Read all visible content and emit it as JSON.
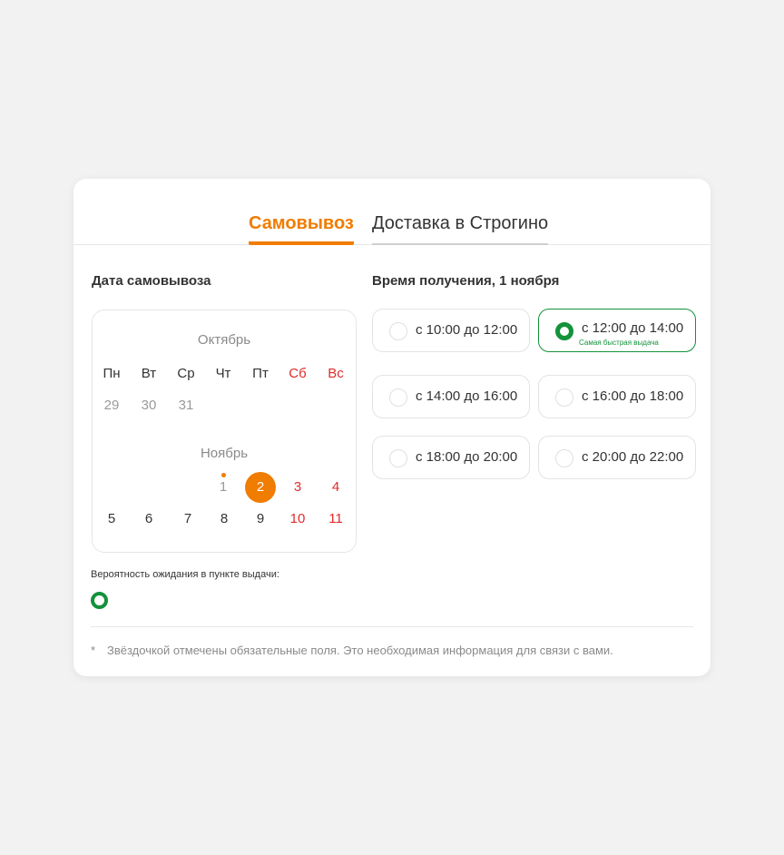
{
  "tabs": [
    {
      "label": "Самовывоз",
      "active": true
    },
    {
      "label": "Доставка в Строгино",
      "active": false
    }
  ],
  "date_section": {
    "title": "Дата самовывоза"
  },
  "time_section": {
    "title": "Время получения, 1 ноября"
  },
  "calendar": {
    "weekdays": [
      "Пн",
      "Вт",
      "Ср",
      "Чт",
      "Пт",
      "Сб",
      "Вс"
    ],
    "months": [
      {
        "name": "Октябрь",
        "days": [
          "29",
          "30",
          "31"
        ]
      },
      {
        "name": "Ноябрь",
        "days": [
          "1",
          "2",
          "3",
          "4",
          "5",
          "6",
          "7",
          "8",
          "9",
          "10",
          "11"
        ]
      }
    ],
    "today": "1",
    "selected": "2"
  },
  "time_slots": [
    {
      "label": "с 10:00 до 12:00",
      "selected": false,
      "note": ""
    },
    {
      "label": "с 12:00 до 14:00",
      "selected": true,
      "note": "Самая быстрая выдача"
    },
    {
      "label": "с 14:00 до 16:00",
      "selected": false,
      "note": ""
    },
    {
      "label": "с 16:00 до 18:00",
      "selected": false,
      "note": ""
    },
    {
      "label": "с 18:00 до 20:00",
      "selected": false,
      "note": ""
    },
    {
      "label": "с 20:00 до 22:00",
      "selected": false,
      "note": ""
    }
  ],
  "wait": {
    "label": "Вероятность ожидания в пункте выдачи:",
    "indicator_color": "#13923a"
  },
  "footnote": {
    "star": "*",
    "text": "Звёздочкой отмечены обязательные поля. Это необходимая информация для связи с вами."
  },
  "colors": {
    "accent": "#f07c00",
    "success": "#13923a",
    "weekend": "#e02b2b"
  }
}
